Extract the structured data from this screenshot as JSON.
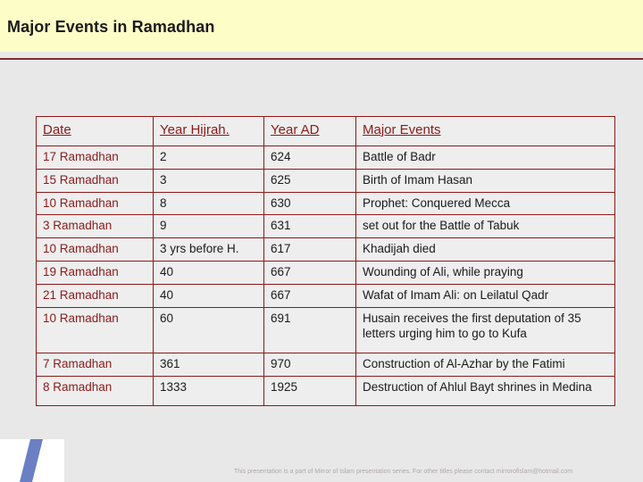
{
  "slide": {
    "title": "Major Events in Ramadhan",
    "footer_note": "This presentation is a part of Mirror of Islam presentation series. For other titles please contact mirrorofislam@hotmail.com"
  },
  "table": {
    "columns": [
      "Date",
      "Year Hijrah.",
      "Year AD",
      "Major Events"
    ],
    "rows": [
      [
        "17 Ramadhan",
        "2",
        "624",
        "Battle of Badr"
      ],
      [
        "15 Ramadhan",
        "3",
        "625",
        "Birth of Imam Hasan"
      ],
      [
        "10 Ramadhan",
        "8",
        "630",
        "Prophet: Conquered Mecca"
      ],
      [
        "3 Ramadhan",
        "9",
        "631",
        "set out for the Battle of Tabuk"
      ],
      [
        "10 Ramadhan",
        "3 yrs before H.",
        "617",
        "Khadijah died"
      ],
      [
        "19 Ramadhan",
        "40",
        "667",
        "Wounding of Ali, while praying"
      ],
      [
        "21 Ramadhan",
        "40",
        "667",
        "Wafat of Imam Ali: on Leilatul Qadr"
      ],
      [
        "10 Ramadhan",
        "60",
        "691",
        "Husain receives the first deputation of 35 letters urging him to go to Kufa"
      ],
      [
        "7 Ramadhan",
        "361",
        "970",
        "Construction of Al-Azhar by the Fatimi"
      ],
      [
        "8 Ramadhan",
        "1333",
        "1925",
        "Destruction of Ahlul Bayt shrines in Medina"
      ]
    ]
  }
}
